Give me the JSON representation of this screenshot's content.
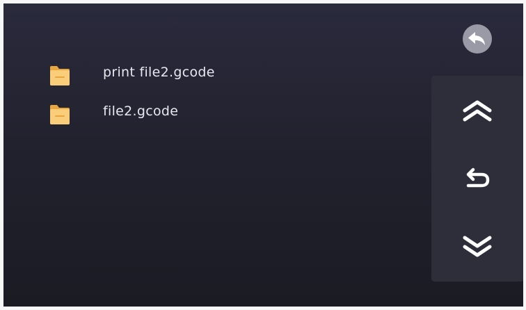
{
  "file_list": {
    "items": [
      {
        "name": "print file2.gcode",
        "icon": "folder-icon"
      },
      {
        "name": "file2.gcode",
        "icon": "folder-icon"
      }
    ]
  },
  "controls": {
    "back": {
      "icon": "back-arrow-icon"
    },
    "page_up": {
      "icon": "double-chevron-up-icon"
    },
    "return": {
      "icon": "return-arrow-icon"
    },
    "page_down": {
      "icon": "double-chevron-down-icon"
    }
  },
  "colors": {
    "background_top": "#2a2a3d",
    "background_bottom": "#1b1b24",
    "panel": "#2e2e3a",
    "folder": "#f7c46a",
    "text": "#e8e8ee",
    "icon": "#ffffff"
  }
}
